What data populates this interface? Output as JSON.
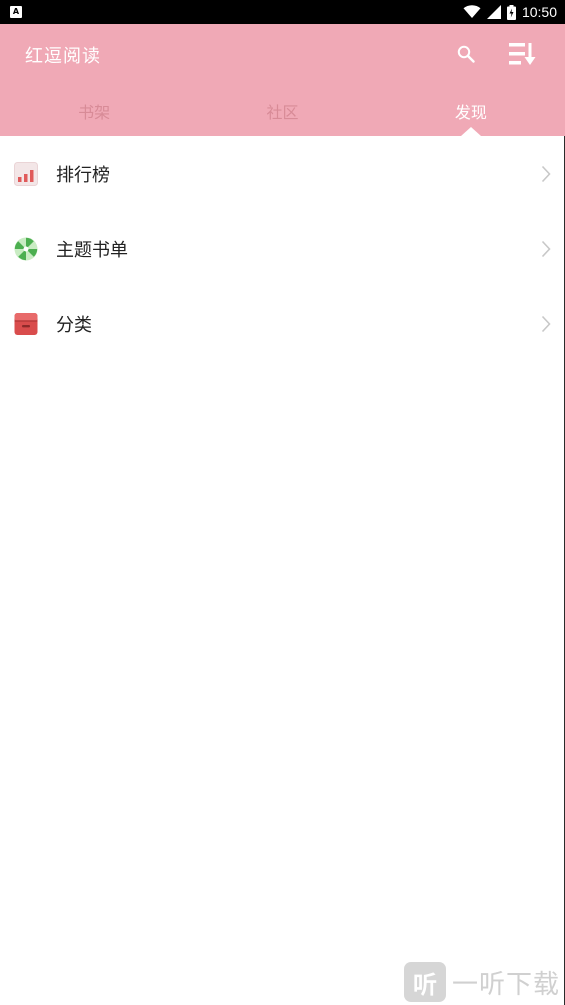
{
  "status_bar": {
    "notification_glyph": "A",
    "time": "10:50"
  },
  "header": {
    "title": "红逗阅读",
    "background": "#f0a9b6",
    "tabs": [
      {
        "label": "书架",
        "active": false
      },
      {
        "label": "社区",
        "active": false
      },
      {
        "label": "发现",
        "active": true
      }
    ]
  },
  "menu": {
    "items": [
      {
        "label": "排行榜",
        "icon": "bar-chart-icon"
      },
      {
        "label": "主题书单",
        "icon": "pinwheel-icon"
      },
      {
        "label": "分类",
        "icon": "archive-box-icon"
      }
    ]
  },
  "watermark": {
    "badge": "听",
    "text": "一听下载"
  }
}
